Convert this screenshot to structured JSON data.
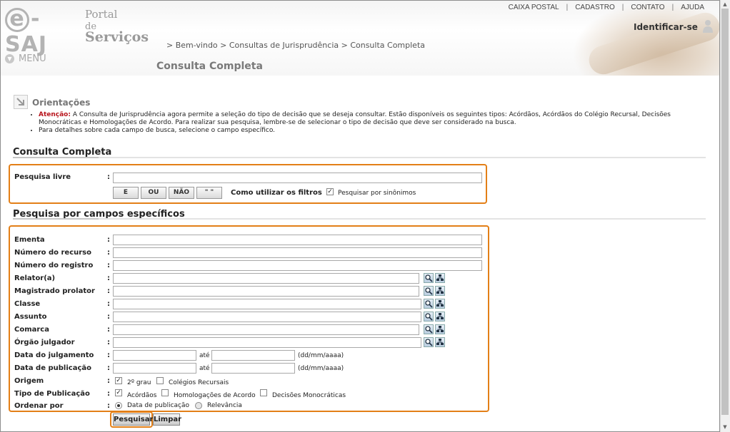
{
  "header": {
    "logo_main": "e-SAJ",
    "logo_portal": "Portal",
    "logo_de": "de",
    "logo_servicos": "Serviços",
    "top_nav": [
      "CAIXA POSTAL",
      "CADASTRO",
      "CONTATO",
      "AJUDA"
    ],
    "identify": "Identificar-se",
    "menu_label": "MENU",
    "breadcrumb": "> Bem-vindo > Consultas de Jurisprudência > Consulta Completa",
    "page_title": "Consulta Completa"
  },
  "orientacoes": {
    "title": "Orientações",
    "warn_label": "Atenção:",
    "line1": "A Consulta de Jurisprudência agora permite a seleção do tipo de decisão que se deseja consultar. Estão disponíveis os seguintes tipos: Acórdãos, Acórdãos do Colégio Recursal, Decisões Monocráticas e Homologações de Acordo. Para realizar sua pesquisa, lembre-se de selecionar o tipo de decisão que deve ser considerado na busca.",
    "line2": "Para detalhes sobre cada campo de busca, selecione o campo específico."
  },
  "consulta": {
    "section_title": "Consulta Completa",
    "pesquisa_livre_label": "Pesquisa livre",
    "pesquisa_livre_value": "",
    "operators": [
      "E",
      "OU",
      "NÃO",
      "\" \""
    ],
    "filters_help": "Como utilizar os filtros",
    "synonyms_label": "Pesquisar por sinônimos",
    "synonyms_checked": true
  },
  "campos": {
    "section_title": "Pesquisa por campos específicos",
    "ementa": "Ementa",
    "numero_recurso": "Número do recurso",
    "numero_registro": "Número do registro",
    "relator": "Relator(a)",
    "magistrado": "Magistrado prolator",
    "classe": "Classe",
    "assunto": "Assunto",
    "comarca": "Comarca",
    "orgao": "Órgão julgador",
    "data_julgamento": "Data do julgamento",
    "data_publicacao": "Data de publicação",
    "ate": "até",
    "date_format": "(dd/mm/aaaa)",
    "origem": "Origem",
    "origem_opt1": "2º grau",
    "origem_opt2": "Colégios Recursais",
    "tipo_publicacao": "Tipo de Publicação",
    "tipo_opt1": "Acórdãos",
    "tipo_opt2": "Homologações de Acordo",
    "tipo_opt3": "Decisões Monocráticas",
    "ordenar": "Ordenar por",
    "ordenar_opt1": "Data de publicação",
    "ordenar_opt2": "Relevância",
    "colon": ":"
  },
  "actions": {
    "search": "Pesquisar",
    "clear": "Limpar"
  },
  "colors": {
    "highlight": "#e37f17",
    "warning": "#b8141c"
  }
}
